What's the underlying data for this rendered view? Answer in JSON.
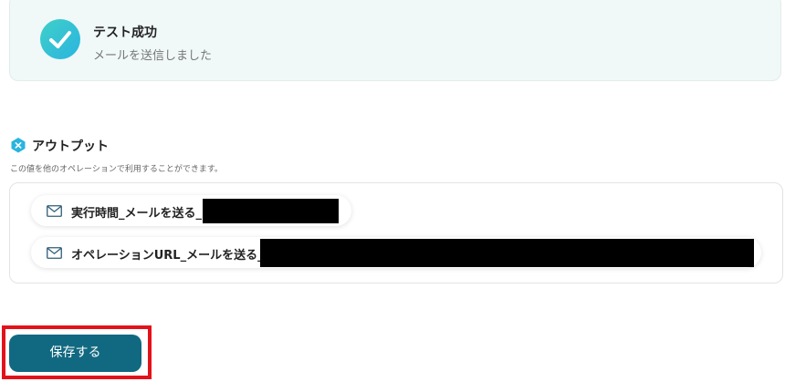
{
  "success": {
    "title": "テスト成功",
    "message": "メールを送信しました",
    "icon": "check-circle-icon",
    "accent_color": "#2ab4e0"
  },
  "output": {
    "title": "アウトプット",
    "description": "この値を他のオペレーションで利用することができます。",
    "icon": "output-hexagon-icon",
    "items": [
      {
        "label": "実行時間_メールを送る_",
        "icon": "mail-icon"
      },
      {
        "label": "オペレーションURL_メールを送る_",
        "icon": "mail-icon"
      }
    ]
  },
  "actions": {
    "save_label": "保存する",
    "save_color": "#116981",
    "highlight_color": "#e3121a"
  }
}
